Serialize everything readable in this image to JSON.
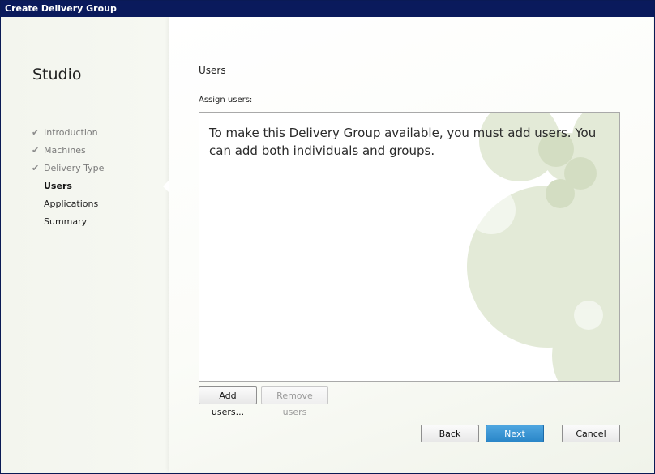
{
  "window": {
    "title": "Create Delivery Group"
  },
  "sidebar": {
    "app_title": "Studio",
    "steps": [
      {
        "label": "Introduction",
        "state": "done"
      },
      {
        "label": "Machines",
        "state": "done"
      },
      {
        "label": "Delivery Type",
        "state": "done"
      },
      {
        "label": "Users",
        "state": "current"
      },
      {
        "label": "Applications",
        "state": "pending"
      },
      {
        "label": "Summary",
        "state": "pending"
      }
    ],
    "check_glyph": "✔"
  },
  "main": {
    "section_title": "Users",
    "assign_label": "Assign users:",
    "empty_message": "To make this Delivery Group available, you must add users. You can add both individuals and groups.",
    "add_users_label": "Add users...",
    "remove_users_label": "Remove users",
    "remove_users_enabled": false
  },
  "footer": {
    "back_label": "Back",
    "next_label": "Next",
    "cancel_label": "Cancel"
  },
  "colors": {
    "titlebar": "#0a1a5c",
    "primary_button": "#2a86c8",
    "decor_green": "#dde6cf"
  }
}
